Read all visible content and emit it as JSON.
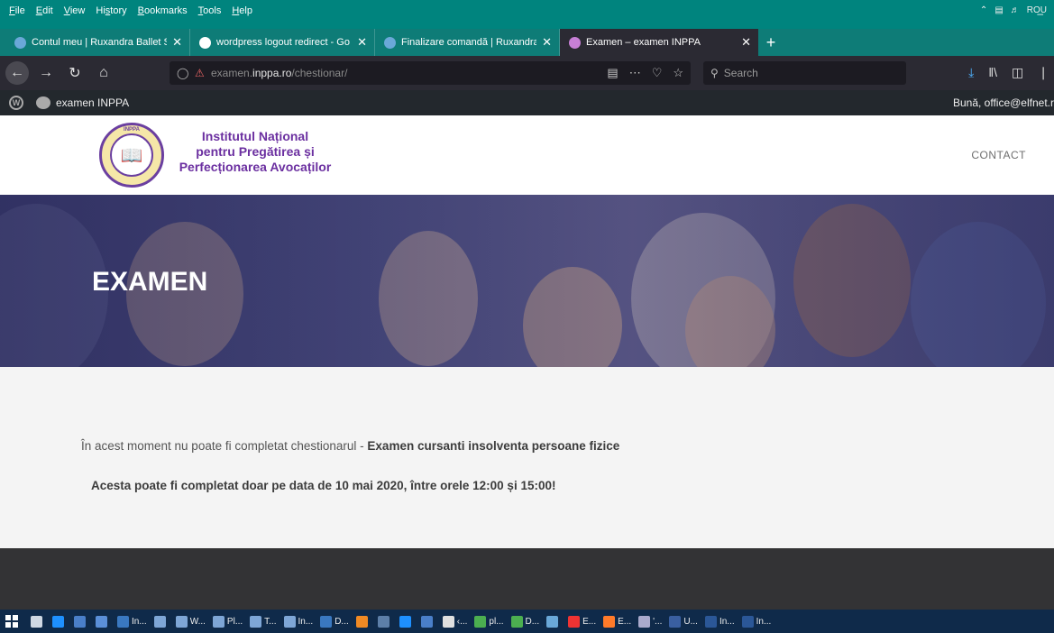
{
  "browser": {
    "menu": [
      {
        "u": "F",
        "rest": "ile"
      },
      {
        "u": "E",
        "rest": "dit"
      },
      {
        "u": "V",
        "rest": "iew"
      },
      {
        "u": "",
        "rest": "Hi",
        "u2": "s",
        "rest2": "tory"
      },
      {
        "u": "B",
        "rest": "ookmarks"
      },
      {
        "u": "T",
        "rest": "ools"
      },
      {
        "u": "H",
        "rest": "elp"
      }
    ],
    "minimize": "–",
    "tabs": [
      {
        "title": "Contul meu | Ruxandra Ballet S",
        "fav": "#6aa8d8"
      },
      {
        "title": "wordpress logout redirect - Go",
        "fav": "#ffffff"
      },
      {
        "title": "Finalizare comandă | Ruxandra",
        "fav": "#6aa8d8"
      },
      {
        "title": "Examen – examen INPPA",
        "fav": "#c77fd6"
      }
    ],
    "url_domain_prefix": "examen.",
    "url_domain": "inppa.ro",
    "url_path": "/chestionar/",
    "search_placeholder": "Search"
  },
  "adminbar": {
    "site_name": "examen INPPA",
    "greeting": "Bună, office@elfnet.r"
  },
  "header": {
    "org_line1": "Institutul Național",
    "org_line2": "pentru Pregătirea și",
    "org_line3": "Perfecționarea Avocaților",
    "seal_text": "INPPA",
    "contact": "CONTACT"
  },
  "hero": {
    "title": "EXAMEN"
  },
  "content": {
    "msg1_pre": "În acest moment nu poate fi completat chestionarul - ",
    "msg1_bold": "Examen cursanti insolventa persoane fizice",
    "msg2": "Acesta poate fi completat doar pe data de 10 mai 2020, între orele 12:00 și 15:00!"
  },
  "taskbar": {
    "items": [
      {
        "label": "",
        "color": "#cfd8e3"
      },
      {
        "label": "",
        "color": "#1e90ff"
      },
      {
        "label": "",
        "color": "#4a7fc9"
      },
      {
        "label": "",
        "color": "#5b8fd8"
      },
      {
        "label": "In...",
        "color": "#3a78c0"
      },
      {
        "label": "",
        "color": "#7ea6d6"
      },
      {
        "label": "W...",
        "color": "#7ea6d6"
      },
      {
        "label": "Pl...",
        "color": "#7ea6d6"
      },
      {
        "label": "T...",
        "color": "#7ea6d6"
      },
      {
        "label": "In...",
        "color": "#7ea6d6"
      },
      {
        "label": "D...",
        "color": "#3a78c0"
      },
      {
        "label": "",
        "color": "#f08a24"
      },
      {
        "label": "",
        "color": "#5d7fa8"
      },
      {
        "label": "",
        "color": "#1e90ff"
      },
      {
        "label": "",
        "color": "#4a7fc9"
      },
      {
        "label": "‹...",
        "color": "#e0e0e0"
      },
      {
        "label": "pl...",
        "color": "#4caf50"
      },
      {
        "label": "D...",
        "color": "#4caf50"
      },
      {
        "label": "",
        "color": "#6aa8d8"
      },
      {
        "label": "E...",
        "color": "#e33"
      },
      {
        "label": "E...",
        "color": "#ff7b2a"
      },
      {
        "label": "'...",
        "color": "#aac"
      },
      {
        "label": "U...",
        "color": "#3a5fa0"
      },
      {
        "label": "In...",
        "color": "#2b5797"
      },
      {
        "label": "In...",
        "color": "#2b5797"
      }
    ],
    "tray_lang": "ROU"
  }
}
